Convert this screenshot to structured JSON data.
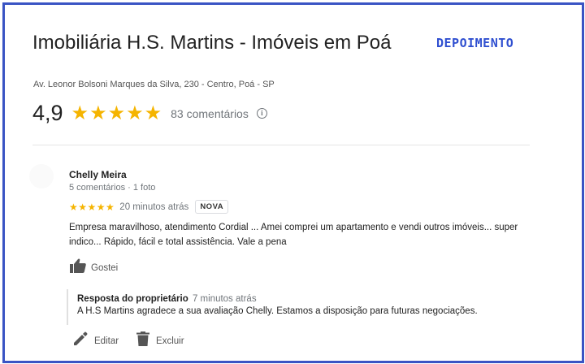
{
  "business": {
    "title": "Imobiliária H.S. Martins - Imóveis em Poá",
    "address": "Av. Leonor Bolsoni Marques da Silva, 230 - Centro, Poá - SP",
    "badge": "DEPOIMENTO"
  },
  "rating": {
    "score": "4,9",
    "stars": "★★★★★",
    "count_label": "83 comentários",
    "info_icon": "info-icon"
  },
  "review": {
    "author": "Chelly Meira",
    "meta": "5 comentários · 1 foto",
    "stars": "★★★★★",
    "time": "20 minutos atrás",
    "tag": "NOVA",
    "text": "Empresa maravilhoso, atendimento Cordial ... Amei comprei  um apartamento e vendi outros imóveis... super indico... Rápido, fácil e total assistência. Vale a pena",
    "like_label": "Gostei"
  },
  "reply": {
    "owner_label": "Resposta do proprietário",
    "time": "7 minutos atrás",
    "text": "A H.S Martins agradece a sua avaliação Chelly. Estamos a disposição para futuras negociações."
  },
  "actions": {
    "edit_label": "Editar",
    "delete_label": "Excluir"
  },
  "colors": {
    "frame_border": "#3a54c4",
    "badge": "#2f4fd0",
    "star": "#f5b400"
  }
}
